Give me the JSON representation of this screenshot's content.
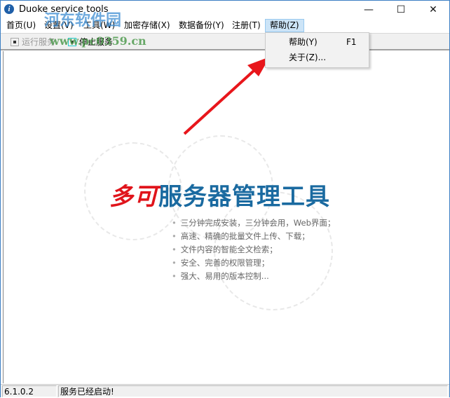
{
  "window": {
    "title": "Duoke service tools",
    "minimize": "—",
    "maximize": "☐",
    "close": "✕"
  },
  "menubar": [
    {
      "label": "首页(U)"
    },
    {
      "label": "设置(V)"
    },
    {
      "label": "工具(W)"
    },
    {
      "label": "加密存储(X)"
    },
    {
      "label": "数据备份(Y)"
    },
    {
      "label": "注册(T)"
    },
    {
      "label": "帮助(Z)"
    }
  ],
  "toolbar": {
    "start": "运行服务",
    "stop": "停止服务"
  },
  "dropdown": {
    "items": [
      {
        "label": "帮助(Y)",
        "shortcut": "F1"
      },
      {
        "label": "关于(Z)..."
      }
    ]
  },
  "splash": {
    "brand_red": "多可",
    "brand_blue": "服务器管理工具",
    "features": [
      "三分钟完成安装，三分钟会用，Web界面；",
      "高速、精确的批量文件上传、下载；",
      "文件内容的智能全文检索；",
      "安全、完善的权限管理；",
      "强大、易用的版本控制..."
    ]
  },
  "status": {
    "version": "6.1.0.2",
    "message": "服务已经启动!"
  },
  "watermark": {
    "site": "河东软件园",
    "url": "www.pc0359.cn"
  },
  "colors": {
    "accent": "#cce4f7",
    "brand_red": "#e0141b",
    "brand_blue": "#1a6aa0",
    "arrow": "#e8161b"
  }
}
